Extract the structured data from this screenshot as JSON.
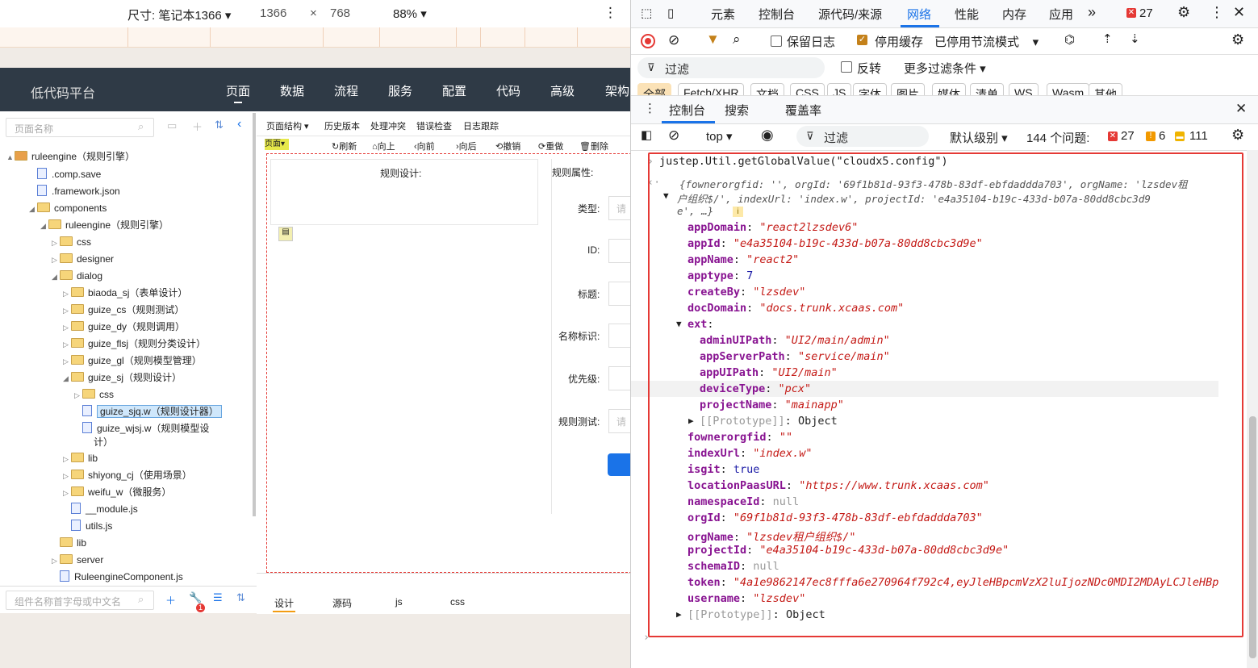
{
  "devtools_bar": {
    "size_label": "尺寸: 笔记本1366",
    "width": "1366",
    "x": "×",
    "height": "768",
    "zoom": "88%"
  },
  "app": {
    "title": "低代码平台",
    "nav": [
      "页面",
      "数据",
      "流程",
      "服务",
      "配置",
      "代码",
      "高级",
      "架构"
    ]
  },
  "tree": {
    "search_placeholder": "页面名称",
    "bottom_placeholder": "组件名称首字母或中文名",
    "badge": "1",
    "items": [
      {
        "label": "ruleengine（规则引擎）",
        "type": "root",
        "toggle": "▲"
      },
      {
        "label": ".comp.save",
        "type": "file",
        "toggle": ""
      },
      {
        "label": ".framework.json",
        "type": "file",
        "toggle": ""
      },
      {
        "label": "components",
        "type": "folder",
        "toggle": "◢"
      },
      {
        "label": "ruleengine（规则引擎）",
        "type": "folder",
        "toggle": "◢"
      },
      {
        "label": "css",
        "type": "folder",
        "toggle": "▷"
      },
      {
        "label": "designer",
        "type": "folder",
        "toggle": "▷"
      },
      {
        "label": "dialog",
        "type": "folder",
        "toggle": "◢"
      },
      {
        "label": "biaoda_sj（表单设计）",
        "type": "folder",
        "toggle": "▷"
      },
      {
        "label": "guize_cs（规则测试）",
        "type": "folder",
        "toggle": "▷"
      },
      {
        "label": "guize_dy（规则调用）",
        "type": "folder",
        "toggle": "▷"
      },
      {
        "label": "guize_flsj（规则分类设计）",
        "type": "folder",
        "toggle": "▷"
      },
      {
        "label": "guize_gl（规则模型管理）",
        "type": "folder",
        "toggle": "▷"
      },
      {
        "label": "guize_sj（规则设计）",
        "type": "folder",
        "toggle": "◢"
      },
      {
        "label": "css",
        "type": "folder",
        "toggle": "▷"
      },
      {
        "label": "guize_sjq.w（规则设计器）",
        "type": "file",
        "toggle": ""
      },
      {
        "label": "guize_wjsj.w（规则模型设",
        "type": "file",
        "toggle": ""
      },
      {
        "label": "计）",
        "type": "cont",
        "toggle": ""
      },
      {
        "label": "lib",
        "type": "folder",
        "toggle": "▷"
      },
      {
        "label": "shiyong_cj（使用场景）",
        "type": "folder",
        "toggle": "▷"
      },
      {
        "label": "weifu_w（微服务）",
        "type": "folder",
        "toggle": "▷"
      },
      {
        "label": "__module.js",
        "type": "file",
        "toggle": ""
      },
      {
        "label": "utils.js",
        "type": "file",
        "toggle": ""
      },
      {
        "label": "lib",
        "type": "folder",
        "toggle": ""
      },
      {
        "label": "server",
        "type": "folder",
        "toggle": "▷"
      },
      {
        "label": "RuleengineComponent.js",
        "type": "file",
        "toggle": ""
      }
    ]
  },
  "designer": {
    "toolbar1": [
      "页面结构 ▾",
      "历史版本",
      "处理冲突",
      "错误检查",
      "日志跟踪"
    ],
    "toolbar2": [
      "刷新",
      "向上",
      "向前",
      "向后",
      "撤销",
      "重做",
      "删除"
    ],
    "page_tag": "页面",
    "rule_design": "规则设计:",
    "rule_props": "规则属性:",
    "fields": [
      "类型:",
      "ID:",
      "标题:",
      "名称标识:",
      "优先级:",
      "规则测试:"
    ],
    "input_placeholder": "请",
    "bottom_tabs": [
      "设计",
      "源码",
      "js",
      "css"
    ]
  },
  "devtools": {
    "top_tabs": [
      "元素",
      "控制台",
      "源代码/来源",
      "网络",
      "性能",
      "内存",
      "应用"
    ],
    "error_count": "27",
    "network_row": {
      "preserve_log": "保留日志",
      "disable_cache": "停用缓存",
      "throttle": "已停用节流模式"
    },
    "filter_row": {
      "filter": "过滤",
      "invert": "反转",
      "more": "更多过滤条件"
    },
    "type_chips": [
      "全部",
      "Fetch/XHR",
      "文档",
      "CSS",
      "JS",
      "字体",
      "图片",
      "媒体",
      "清单",
      "WS",
      "Wasm",
      "其他"
    ],
    "drawer_tabs": [
      "控制台",
      "搜索",
      "覆盖率"
    ],
    "console_toolbar": {
      "context": "top",
      "filter": "过滤",
      "level": "默认级别",
      "issues": "144 个问题:",
      "errors": "27",
      "warnings": "6",
      "info": "111"
    }
  },
  "console": {
    "command": "justep.Util.getGlobalValue(\"cloudx5.config\")",
    "preview1": "{fownerorgfid: '', orgId: '69f1b81d-93f3-478b-83df-ebfdaddda703', orgName: 'lzsdev租",
    "preview2": "户组织$/', indexUrl: 'index.w', projectId: 'e4a35104-b19c-433d-b07a-80dd8cbc3d9",
    "preview3": "e', …}",
    "entries": [
      {
        "key": "appDomain",
        "val": "\"react2lzsdev6\"",
        "kind": "s",
        "indent": 0
      },
      {
        "key": "appId",
        "val": "\"e4a35104-b19c-433d-b07a-80dd8cbc3d9e\"",
        "kind": "s",
        "indent": 0
      },
      {
        "key": "appName",
        "val": "\"react2\"",
        "kind": "s",
        "indent": 0
      },
      {
        "key": "apptype",
        "val": "7",
        "kind": "n",
        "indent": 0
      },
      {
        "key": "createBy",
        "val": "\"lzsdev\"",
        "kind": "s",
        "indent": 0
      },
      {
        "key": "docDomain",
        "val": "\"docs.trunk.xcaas.com\"",
        "kind": "s",
        "indent": 0
      },
      {
        "key": "ext",
        "val": "",
        "kind": "obj",
        "indent": 0
      },
      {
        "key": "adminUIPath",
        "val": "\"UI2/main/admin\"",
        "kind": "s",
        "indent": 1
      },
      {
        "key": "appServerPath",
        "val": "\"service/main\"",
        "kind": "s",
        "indent": 1
      },
      {
        "key": "appUIPath",
        "val": "\"UI2/main\"",
        "kind": "s",
        "indent": 1
      },
      {
        "key": "deviceType",
        "val": "\"pcx\"",
        "kind": "s",
        "indent": 1
      },
      {
        "key": "projectName",
        "val": "\"mainapp\"",
        "kind": "s",
        "indent": 1
      },
      {
        "key": "[[Prototype]]",
        "val": "Object",
        "kind": "proto",
        "indent": 1
      },
      {
        "key": "fownerorgfid",
        "val": "\"\"",
        "kind": "s",
        "indent": 0
      },
      {
        "key": "indexUrl",
        "val": "\"index.w\"",
        "kind": "s",
        "indent": 0
      },
      {
        "key": "isgit",
        "val": "true",
        "kind": "n",
        "indent": 0
      },
      {
        "key": "locationPaasURL",
        "val": "\"https://www.trunk.xcaas.com\"",
        "kind": "s",
        "indent": 0
      },
      {
        "key": "namespaceId",
        "val": "null",
        "kind": "g",
        "indent": 0
      },
      {
        "key": "orgId",
        "val": "\"69f1b81d-93f3-478b-83df-ebfdaddda703\"",
        "kind": "s",
        "indent": 0
      },
      {
        "key": "orgName",
        "val": "\"lzsdev租户组织$/\"",
        "kind": "s",
        "indent": 0
      },
      {
        "key": "projectId",
        "val": "\"e4a35104-b19c-433d-b07a-80dd8cbc3d9e\"",
        "kind": "s",
        "indent": 0
      },
      {
        "key": "schemaID",
        "val": "null",
        "kind": "g",
        "indent": 0
      },
      {
        "key": "token",
        "val": "\"4a1e9862147ec8fffa6e270964f792c4,eyJleHBpcmVzX2luIjozNDc0MDI2MDAyLCJleHBp",
        "kind": "s",
        "indent": 0
      },
      {
        "key": "username",
        "val": "\"lzsdev\"",
        "kind": "s",
        "indent": 0
      },
      {
        "key": "[[Prototype]]",
        "val": "Object",
        "kind": "proto",
        "indent": -1
      }
    ]
  },
  "colors": {
    "accent": "#1a73e8",
    "error": "#e53935",
    "highlight": "#e53935"
  }
}
